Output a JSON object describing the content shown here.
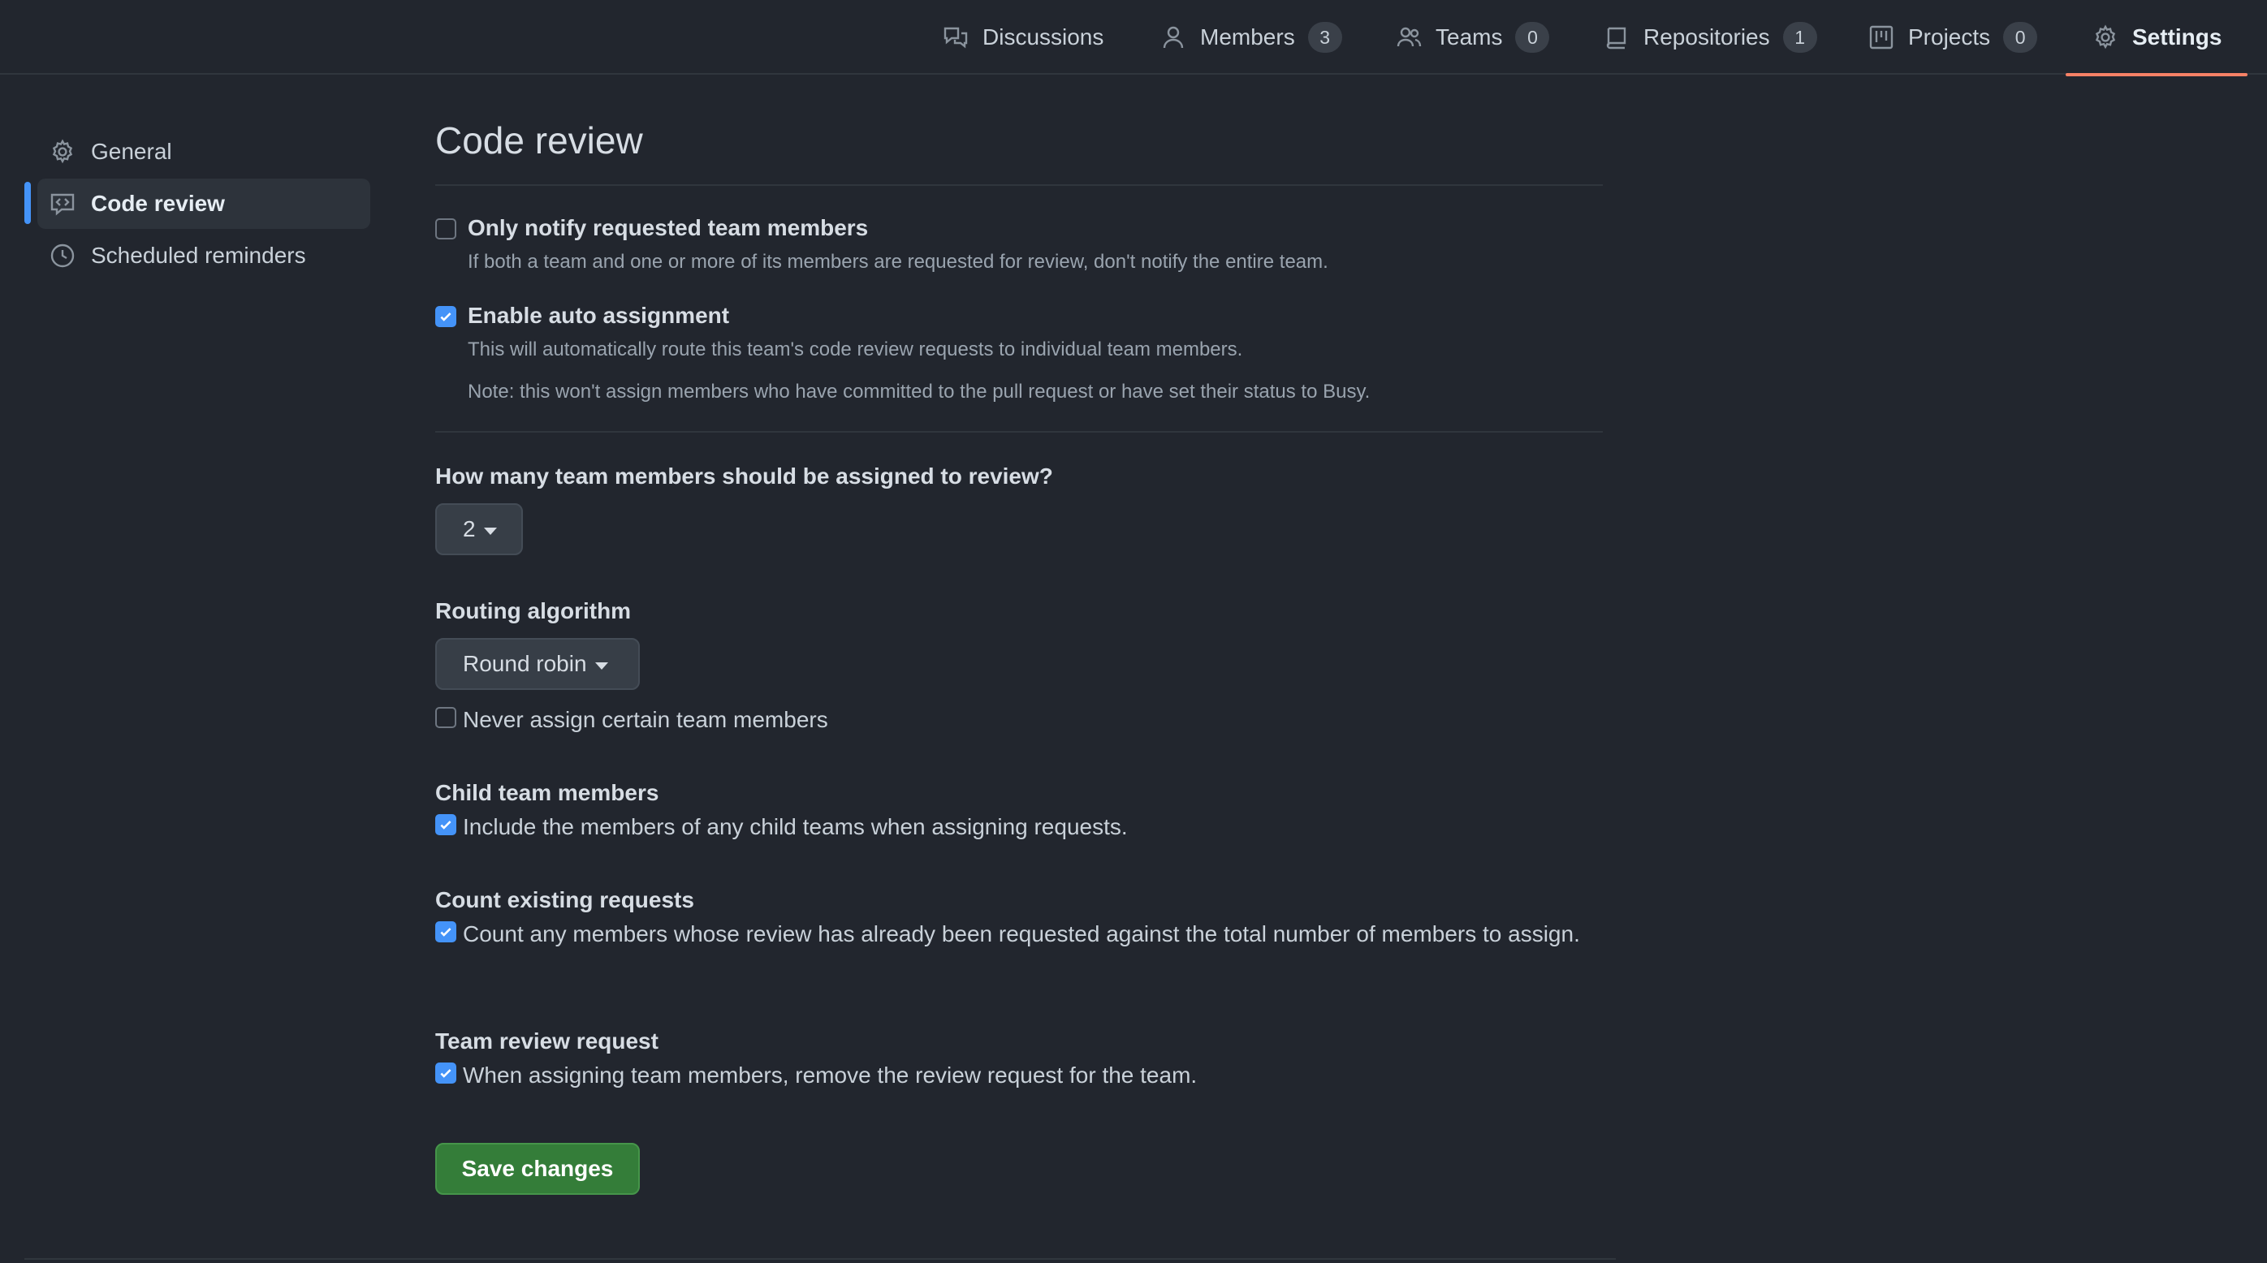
{
  "topnav": {
    "items": [
      {
        "label": "Discussions",
        "count": null,
        "icon": "comment-discussion-icon"
      },
      {
        "label": "Members",
        "count": "3",
        "icon": "person-icon"
      },
      {
        "label": "Teams",
        "count": "0",
        "icon": "people-icon"
      },
      {
        "label": "Repositories",
        "count": "1",
        "icon": "repo-icon"
      },
      {
        "label": "Projects",
        "count": "0",
        "icon": "project-icon"
      },
      {
        "label": "Settings",
        "count": null,
        "icon": "gear-icon"
      }
    ],
    "selected": "Settings"
  },
  "sidebar": {
    "items": [
      {
        "label": "General",
        "icon": "gear-icon"
      },
      {
        "label": "Code review",
        "icon": "code-review-icon"
      },
      {
        "label": "Scheduled reminders",
        "icon": "clock-icon"
      }
    ],
    "active": "Code review"
  },
  "main": {
    "title": "Code review",
    "notify": {
      "label": "Only notify requested team members",
      "note": "If both a team and one or more of its members are requested for review, don't notify the entire team.",
      "checked": false
    },
    "auto_assign": {
      "label": "Enable auto assignment",
      "note1": "This will automatically route this team's code review requests to individual team members.",
      "note2": "Note: this won't assign members who have committed to the pull request or have set their status to Busy.",
      "checked": true
    },
    "how_many": {
      "title": "How many team members should be assigned to review?",
      "value": "2"
    },
    "routing": {
      "title": "Routing algorithm",
      "value": "Round robin"
    },
    "never_assign": {
      "label": "Never assign certain team members",
      "checked": false
    },
    "child_team": {
      "title": "Child team members",
      "label": "Include the members of any child teams when assigning requests.",
      "checked": true
    },
    "count_existing": {
      "title": "Count existing requests",
      "label": "Count any members whose review has already been requested against the total number of members to assign.",
      "checked": true
    },
    "team_review": {
      "title": "Team review request",
      "label": "When assigning team members, remove the review request for the team.",
      "checked": true
    },
    "save_label": "Save changes"
  },
  "colors": {
    "background": "#22262e",
    "accent_blue": "#4493f8",
    "selected_underline": "#f78166",
    "save_green": "#347d39"
  }
}
